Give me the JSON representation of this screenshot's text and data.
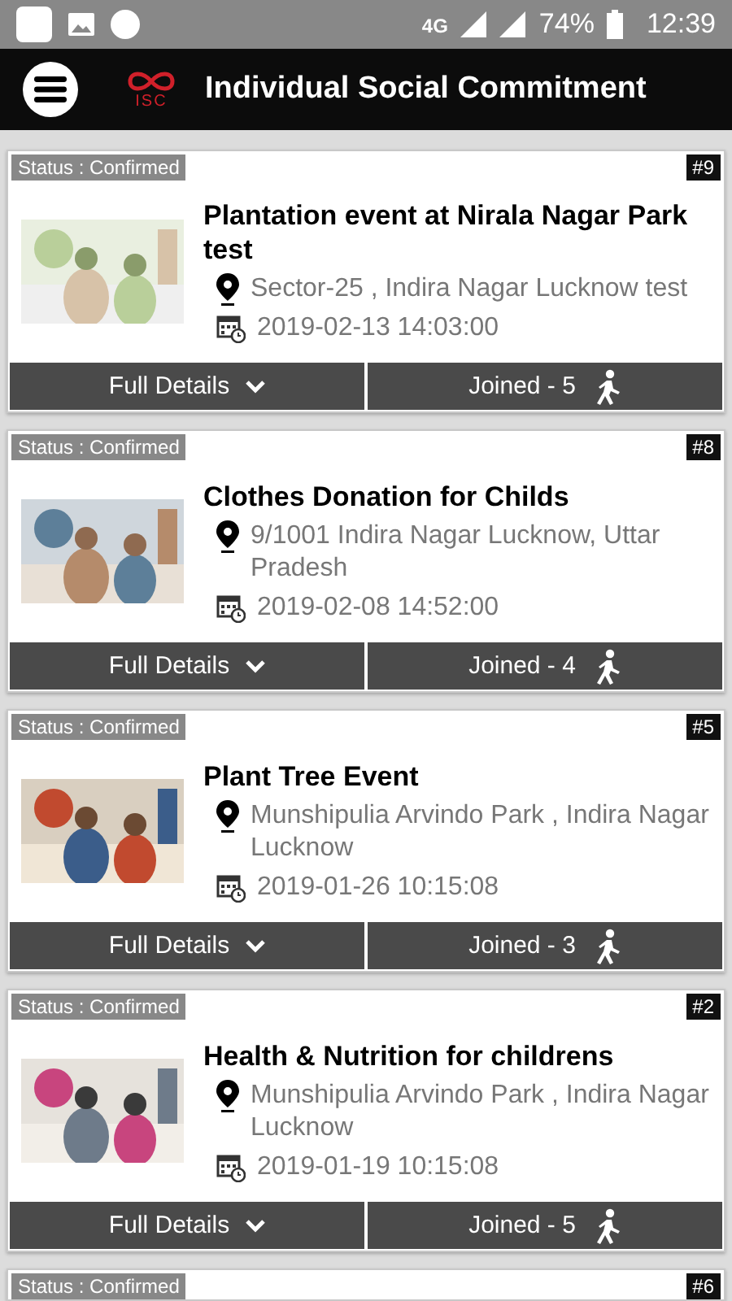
{
  "status_bar": {
    "network": "4G",
    "battery": "74%",
    "time": "12:39"
  },
  "app_bar": {
    "logo_text": "ISC",
    "title": "Individual Social Commitment"
  },
  "events": [
    {
      "status": "Status : Confirmed",
      "number": "#9",
      "title": "Plantation event at Nirala Nagar Park test",
      "address": "Sector-25 , Indira Nagar Lucknow test",
      "datetime": "2019-02-13 14:03:00",
      "details_label": "Full Details",
      "joined": "Joined - 5"
    },
    {
      "status": "Status : Confirmed",
      "number": "#8",
      "title": "Clothes Donation for Childs",
      "address": "9/1001 Indira Nagar Lucknow, Uttar Pradesh",
      "datetime": "2019-02-08 14:52:00",
      "details_label": "Full Details",
      "joined": "Joined - 4"
    },
    {
      "status": "Status : Confirmed",
      "number": "#5",
      "title": "Plant Tree Event",
      "address": "Munshipulia Arvindo Park , Indira Nagar Lucknow",
      "datetime": "2019-01-26 10:15:08",
      "details_label": "Full Details",
      "joined": "Joined - 3"
    },
    {
      "status": "Status : Confirmed",
      "number": "#2",
      "title": "Health & Nutrition for childrens",
      "address": "Munshipulia Arvindo Park , Indira Nagar Lucknow",
      "datetime": "2019-01-19 10:15:08",
      "details_label": "Full Details",
      "joined": "Joined - 5"
    },
    {
      "status": "Status : Confirmed",
      "number": "#6"
    }
  ]
}
